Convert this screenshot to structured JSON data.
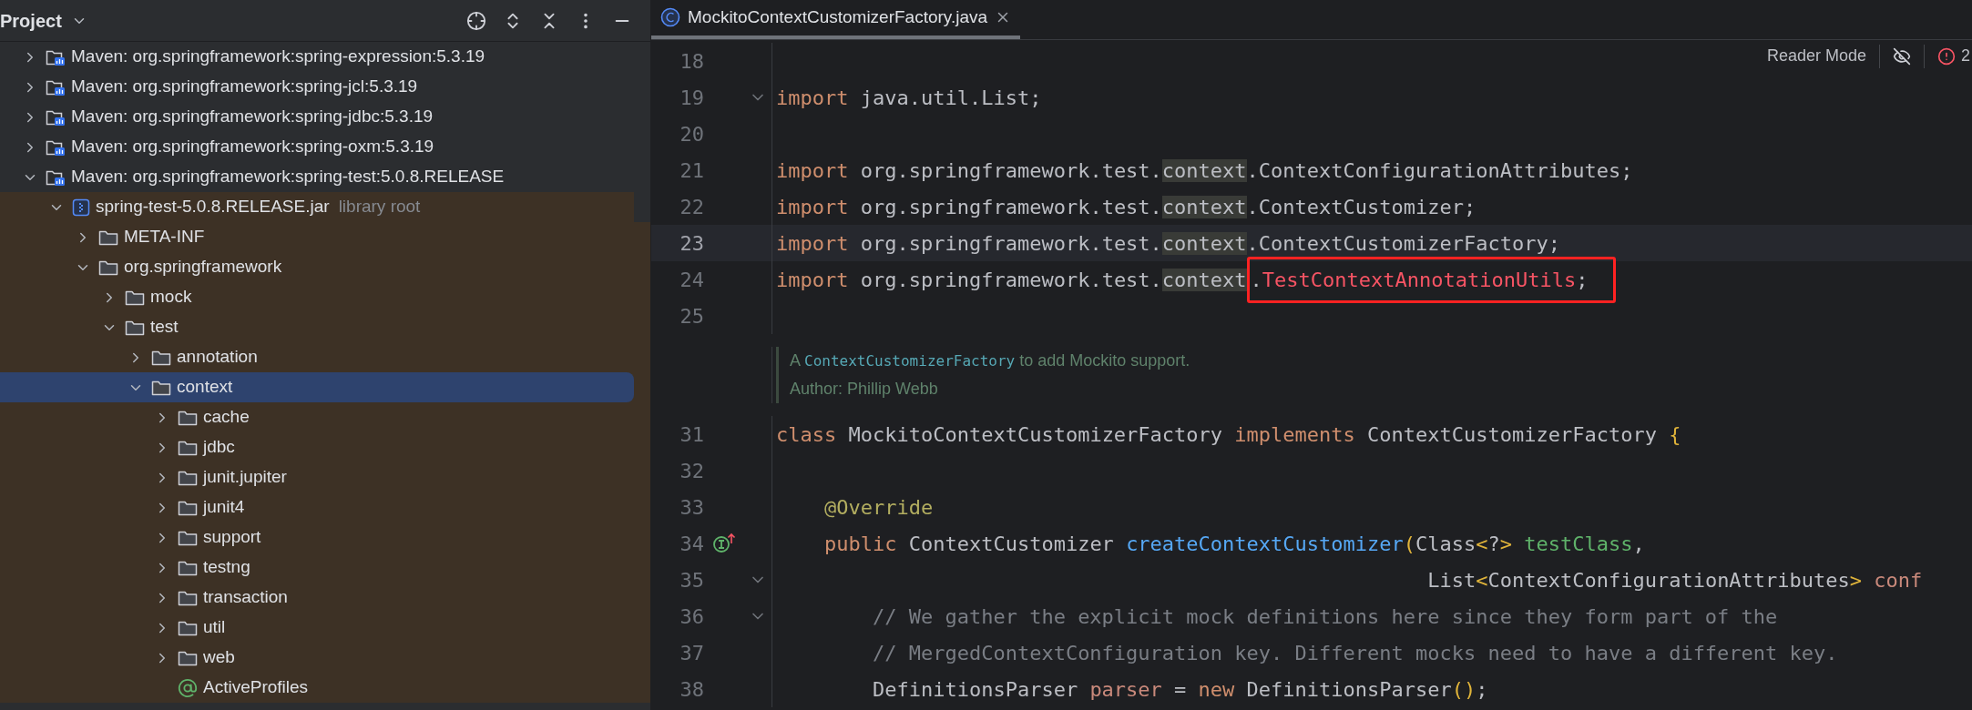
{
  "project_panel": {
    "title": "Project",
    "tree": [
      {
        "kind": "maven",
        "label": "Maven: org.springframework:spring-expression:5.3.19",
        "expanded": false,
        "selected": false
      },
      {
        "kind": "maven",
        "label": "Maven: org.springframework:spring-jcl:5.3.19",
        "expanded": false,
        "selected": false
      },
      {
        "kind": "maven",
        "label": "Maven: org.springframework:spring-jdbc:5.3.19",
        "expanded": false,
        "selected": false
      },
      {
        "kind": "maven",
        "label": "Maven: org.springframework:spring-oxm:5.3.19",
        "expanded": false,
        "selected": false
      },
      {
        "kind": "maven",
        "label": "Maven: org.springframework:spring-test:5.0.8.RELEASE",
        "expanded": true,
        "selected": false,
        "children": [
          {
            "kind": "jar",
            "label": "spring-test-5.0.8.RELEASE.jar",
            "suffix": "library root",
            "expanded": true,
            "selected": false,
            "children": [
              {
                "kind": "folder",
                "label": "META-INF",
                "expanded": false,
                "selected": false
              },
              {
                "kind": "folder",
                "label": "org.springframework",
                "expanded": true,
                "selected": false,
                "children": [
                  {
                    "kind": "folder",
                    "label": "mock",
                    "expanded": false,
                    "selected": false
                  },
                  {
                    "kind": "folder",
                    "label": "test",
                    "expanded": true,
                    "selected": false,
                    "children": [
                      {
                        "kind": "folder",
                        "label": "annotation",
                        "expanded": false,
                        "selected": false
                      },
                      {
                        "kind": "folder",
                        "label": "context",
                        "expanded": true,
                        "selected": true,
                        "children": [
                          {
                            "kind": "folder",
                            "label": "cache",
                            "expanded": false,
                            "selected": false
                          },
                          {
                            "kind": "folder",
                            "label": "jdbc",
                            "expanded": false,
                            "selected": false
                          },
                          {
                            "kind": "folder",
                            "label": "junit.jupiter",
                            "expanded": false,
                            "selected": false
                          },
                          {
                            "kind": "folder",
                            "label": "junit4",
                            "expanded": false,
                            "selected": false
                          },
                          {
                            "kind": "folder",
                            "label": "support",
                            "expanded": false,
                            "selected": false
                          },
                          {
                            "kind": "folder",
                            "label": "testng",
                            "expanded": false,
                            "selected": false
                          },
                          {
                            "kind": "folder",
                            "label": "transaction",
                            "expanded": false,
                            "selected": false
                          },
                          {
                            "kind": "folder",
                            "label": "util",
                            "expanded": false,
                            "selected": false
                          },
                          {
                            "kind": "folder",
                            "label": "web",
                            "expanded": false,
                            "selected": false
                          },
                          {
                            "kind": "annotation",
                            "label": "ActiveProfiles",
                            "selected": false
                          }
                        ]
                      }
                    ]
                  }
                ]
              }
            ]
          }
        ]
      }
    ]
  },
  "editor": {
    "tab": {
      "label": "MockitoContextCustomizerFactory.java",
      "selected": true
    },
    "reader_mode": {
      "label": "Reader Mode",
      "problems": "2"
    },
    "lines": [
      {
        "kind": "code",
        "number": "18",
        "current": false,
        "fold": false
      },
      {
        "kind": "code",
        "number": "19",
        "current": false,
        "fold": true,
        "tokens": [
          {
            "t": "import",
            "kind": "keyword"
          },
          {
            "t": " java.util.List;",
            "kind": "plain"
          }
        ]
      },
      {
        "kind": "code",
        "number": "20",
        "current": false,
        "fold": false
      },
      {
        "kind": "code",
        "number": "21",
        "current": false,
        "fold": false,
        "tokens": [
          {
            "t": "import",
            "kind": "keyword"
          },
          {
            "t": " org.springframework.test.",
            "kind": "plain"
          },
          {
            "t": "context",
            "kind": "match"
          },
          {
            "t": ".ContextConfigurationAttributes;",
            "kind": "plain"
          }
        ]
      },
      {
        "kind": "code",
        "number": "22",
        "current": false,
        "fold": false,
        "tokens": [
          {
            "t": "import",
            "kind": "keyword"
          },
          {
            "t": " org.springframework.test.",
            "kind": "plain"
          },
          {
            "t": "context",
            "kind": "match"
          },
          {
            "t": ".ContextCustomizer;",
            "kind": "plain"
          }
        ]
      },
      {
        "kind": "code",
        "number": "23",
        "current": true,
        "fold": false,
        "tokens": [
          {
            "t": "import",
            "kind": "keyword"
          },
          {
            "t": " org.springframework.test.",
            "kind": "plain"
          },
          {
            "t": "context",
            "kind": "match"
          },
          {
            "t": ".ContextCustomizerFactory;",
            "kind": "plain"
          }
        ]
      },
      {
        "kind": "code",
        "number": "24",
        "current": false,
        "fold": false,
        "tokens": [
          {
            "t": "import",
            "kind": "keyword"
          },
          {
            "t": " org.springframework.test.",
            "kind": "plain"
          },
          {
            "t": "context",
            "kind": "match"
          },
          {
            "t": ".",
            "kind": "plain",
            "boxed": true
          },
          {
            "t": "TestContextAnnotationUtils",
            "kind": "error",
            "boxed": true
          },
          {
            "t": ";",
            "kind": "plain",
            "boxed": true
          }
        ]
      },
      {
        "kind": "code",
        "number": "25",
        "current": false,
        "fold": false
      },
      {
        "kind": "doc",
        "parts": [
          {
            "t": "A ",
            "link": false
          },
          {
            "t": "ContextCustomizerFactory",
            "link": true
          },
          {
            "t": " to add Mockito support.",
            "link": false
          }
        ],
        "author": "Author: Phillip Webb"
      },
      {
        "kind": "code",
        "number": "31",
        "current": false,
        "fold": false,
        "tokens": [
          {
            "t": "class",
            "kind": "keyword"
          },
          {
            "t": " MockitoContextCustomizerFactory ",
            "kind": "plain"
          },
          {
            "t": "implements",
            "kind": "keyword"
          },
          {
            "t": " ContextCustomizerFactory ",
            "kind": "plain"
          },
          {
            "t": "{",
            "kind": "brace"
          }
        ]
      },
      {
        "kind": "code",
        "number": "32",
        "current": false,
        "fold": false
      },
      {
        "kind": "code",
        "number": "33",
        "current": false,
        "fold": false,
        "tokens": [
          {
            "t": "    @Override",
            "kind": "annotation"
          }
        ]
      },
      {
        "kind": "code",
        "number": "34",
        "current": false,
        "fold": false,
        "implements_marker": true,
        "tokens": [
          {
            "t": "    public",
            "kind": "keyword"
          },
          {
            "t": " ContextCustomizer ",
            "kind": "plain"
          },
          {
            "t": "createContextCustomizer",
            "kind": "method"
          },
          {
            "t": "(",
            "kind": "brace"
          },
          {
            "t": "Class",
            "kind": "plain"
          },
          {
            "t": "<",
            "kind": "brace"
          },
          {
            "t": "?",
            "kind": "plain"
          },
          {
            "t": ">",
            "kind": "brace"
          },
          {
            "t": " testClass",
            "kind": "param"
          },
          {
            "t": ",",
            "kind": "plain"
          }
        ]
      },
      {
        "kind": "code",
        "number": "35",
        "current": false,
        "fold": true,
        "tokens": [
          {
            "t": "                                                      List",
            "kind": "plain"
          },
          {
            "t": "<",
            "kind": "brace"
          },
          {
            "t": "ContextConfigurationAttributes",
            "kind": "plain"
          },
          {
            "t": ">",
            "kind": "brace"
          },
          {
            "t": " conf",
            "kind": "local"
          }
        ]
      },
      {
        "kind": "code",
        "number": "36",
        "current": false,
        "fold": true,
        "tokens": [
          {
            "t": "        // We gather the explicit mock definitions here since they form part of the",
            "kind": "comment"
          }
        ]
      },
      {
        "kind": "code",
        "number": "37",
        "current": false,
        "fold": false,
        "tokens": [
          {
            "t": "        // MergedContextConfiguration key. Different mocks need to have a different key.",
            "kind": "comment"
          }
        ]
      },
      {
        "kind": "code",
        "number": "38",
        "current": false,
        "fold": false,
        "tokens": [
          {
            "t": "        DefinitionsParser ",
            "kind": "plain"
          },
          {
            "t": "parser",
            "kind": "local"
          },
          {
            "t": " = ",
            "kind": "plain"
          },
          {
            "t": "new",
            "kind": "keyword"
          },
          {
            "t": " DefinitionsParser",
            "kind": "plain"
          },
          {
            "t": "()",
            "kind": "brace"
          },
          {
            "t": ";",
            "kind": "plain"
          }
        ]
      }
    ]
  }
}
